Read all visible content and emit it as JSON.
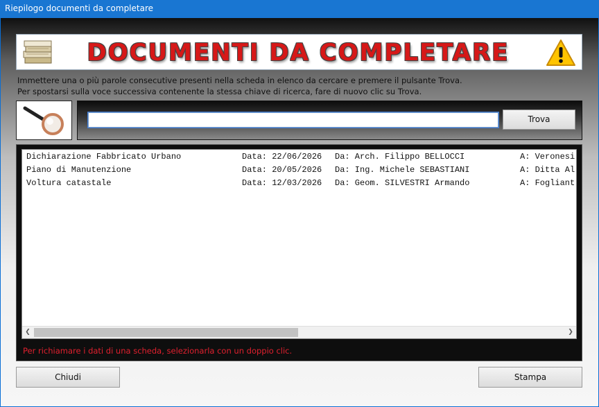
{
  "window": {
    "title": "Riepilogo documenti da completare"
  },
  "banner": {
    "title": "DOCUMENTI DA COMPLETARE"
  },
  "instructions": {
    "line1": "Immettere una o più parole consecutive presenti nella scheda in elenco da cercare e premere il pulsante Trova.",
    "line2": "Per spostarsi sulla voce successiva contenente la stessa chiave di ricerca, fare di nuovo clic su Trova."
  },
  "search": {
    "value": "",
    "button_label": "Trova"
  },
  "list": {
    "rows": [
      {
        "doc": "Dichiarazione Fabbricato Urbano",
        "data": "Data: 22/06/2026",
        "da": "Da: Arch. Filippo BELLOCCI",
        "a": "A: Veronesi"
      },
      {
        "doc": "Piano di Manutenzione",
        "data": "Data: 20/05/2026",
        "da": "Da: Ing. Michele SEBASTIANI",
        "a": "A: Ditta Al"
      },
      {
        "doc": "Voltura catastale",
        "data": "Data: 12/03/2026",
        "da": "Da: Geom. SILVESTRI Armando",
        "a": "A: Fogliant"
      }
    ]
  },
  "hint": "Per richiamare i dati di una scheda, selezionarla con un doppio clic.",
  "footer": {
    "close_label": "Chiudi",
    "print_label": "Stampa"
  },
  "colors": {
    "titlebar": "#1976d2",
    "banner_text": "#d61818",
    "hint": "#e0202e"
  }
}
